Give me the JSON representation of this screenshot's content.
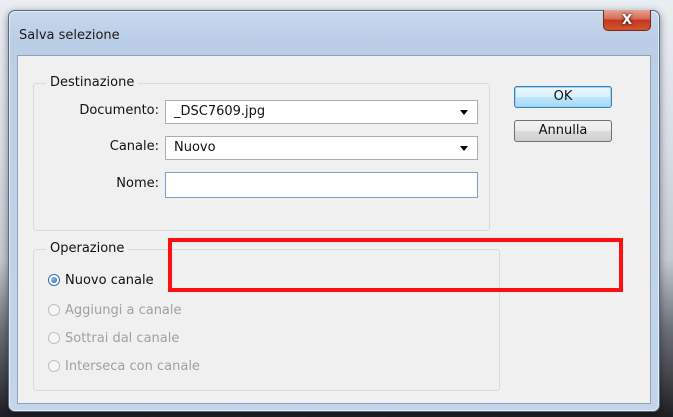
{
  "dialog": {
    "title": "Salva selezione",
    "close_glyph": "X"
  },
  "destinazione": {
    "legend": "Destinazione",
    "documento_label": "Documento:",
    "documento_value": "_DSC7609.jpg",
    "canale_label": "Canale:",
    "canale_value": "Nuovo",
    "nome_label": "Nome:",
    "nome_value": ""
  },
  "operazione": {
    "legend": "Operazione",
    "options": [
      {
        "label": "Nuovo canale",
        "checked": true,
        "enabled": true
      },
      {
        "label": "Aggiungi a canale",
        "checked": false,
        "enabled": false
      },
      {
        "label": "Sottrai dal canale",
        "checked": false,
        "enabled": false
      },
      {
        "label": "Interseca con canale",
        "checked": false,
        "enabled": false
      }
    ]
  },
  "buttons": {
    "ok": "OK",
    "annulla": "Annulla"
  },
  "colors": {
    "annotation": "#ff1010"
  }
}
